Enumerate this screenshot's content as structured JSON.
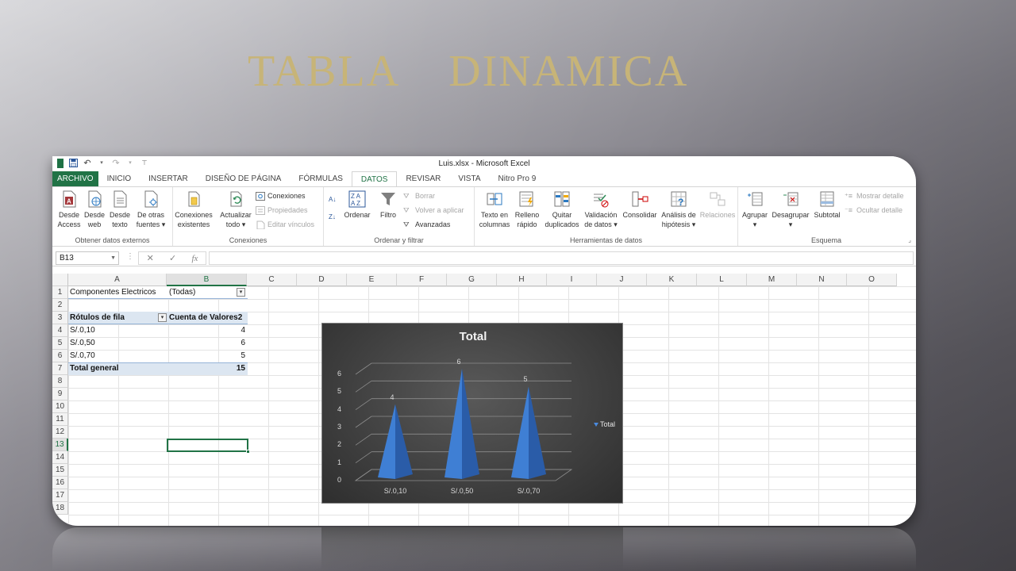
{
  "slide": {
    "title": "TABLA    DINAMICA"
  },
  "window": {
    "title": "Luis.xlsx - Microsoft Excel"
  },
  "tabs": [
    "ARCHIVO",
    "INICIO",
    "INSERTAR",
    "DISEÑO DE PÁGINA",
    "FÓRMULAS",
    "DATOS",
    "REVISAR",
    "VISTA",
    "Nitro Pro 9"
  ],
  "active_tab": "DATOS",
  "ribbon": {
    "external_data": {
      "label": "Obtener datos externos",
      "buttons": [
        "Desde\nAccess",
        "Desde\nweb",
        "Desde\ntexto",
        "De otras\nfuentes ▾"
      ]
    },
    "connections": {
      "label": "Conexiones",
      "existing": "Conexiones\nexistentes",
      "refresh": "Actualizar\ntodo ▾",
      "small": [
        "Conexiones",
        "Propiedades",
        "Editar vínculos"
      ]
    },
    "sort_filter": {
      "label": "Ordenar y filtrar",
      "sort": "Ordenar",
      "filter": "Filtro",
      "small": [
        "Borrar",
        "Volver a aplicar",
        "Avanzadas"
      ]
    },
    "data_tools": {
      "label": "Herramientas de datos",
      "buttons": [
        "Texto en\ncolumnas",
        "Relleno\nrápido",
        "Quitar\nduplicados",
        "Validación\nde datos ▾",
        "Consolidar",
        "Análisis de\nhipótesis ▾",
        "Relaciones"
      ]
    },
    "outline": {
      "label": "Esquema",
      "buttons": [
        "Agrupar\n▾",
        "Desagrupar\n▾",
        "Subtotal"
      ],
      "small": [
        "Mostrar detalle",
        "Ocultar detalle"
      ]
    }
  },
  "formula_bar": {
    "name_box": "B13",
    "fx": "fx",
    "formula": ""
  },
  "sheet": {
    "columns": [
      "A",
      "B",
      "C",
      "D",
      "E",
      "F",
      "G",
      "H",
      "I",
      "J",
      "K",
      "L",
      "M",
      "N",
      "O"
    ],
    "rows": [
      "1",
      "2",
      "3",
      "4",
      "5",
      "6",
      "7",
      "8",
      "9",
      "10",
      "11",
      "12",
      "13",
      "14",
      "15",
      "16",
      "17",
      "18"
    ],
    "selected_column": "B",
    "selected_row": "13"
  },
  "pivot": {
    "filter_label": "Componentes Electricos",
    "filter_value": "(Todas)",
    "row_header": "Rótulos de fila",
    "value_header": "Cuenta de Valores2",
    "rows": [
      {
        "label": "S/.0,10",
        "value": "4"
      },
      {
        "label": "S/.0,50",
        "value": "6"
      },
      {
        "label": "S/.0,70",
        "value": "5"
      }
    ],
    "total_label": "Total general",
    "total_value": "15"
  },
  "chart_data": {
    "type": "bar",
    "shape": "3d-pyramid",
    "title": "Total",
    "categories": [
      "S/.0,10",
      "S/.0,50",
      "S/.0,70"
    ],
    "series": [
      {
        "name": "Total",
        "values": [
          4,
          6,
          5
        ]
      }
    ],
    "ylim": [
      0,
      6
    ],
    "yticks": [
      "0",
      "1",
      "2",
      "3",
      "4",
      "5",
      "6"
    ],
    "xlabel": "",
    "ylabel": "",
    "legend": "right",
    "grid": true,
    "bar_color": "#3f7fd4"
  }
}
